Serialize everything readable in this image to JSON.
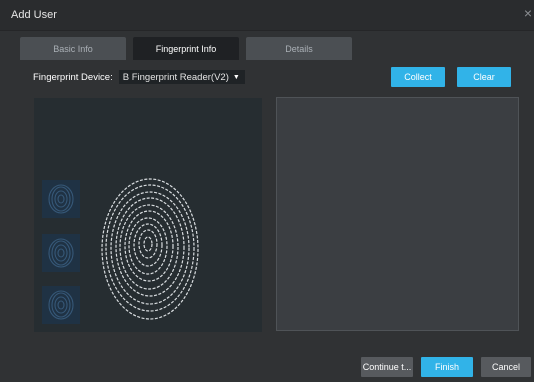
{
  "window": {
    "title": "Add User",
    "close_icon": "close-icon"
  },
  "tabs": [
    {
      "label": "Basic Info",
      "active": false
    },
    {
      "label": "Fingerprint Info",
      "active": true
    },
    {
      "label": "Details",
      "active": false
    }
  ],
  "device": {
    "label": "Fingerprint Device:",
    "value": "B Fingerprint Reader(V2)",
    "icon": "caret-down-icon"
  },
  "actions": {
    "collect": "Collect",
    "clear": "Clear"
  },
  "footer": {
    "continue": "Continue t...",
    "finish": "Finish",
    "cancel": "Cancel"
  },
  "colors": {
    "accent": "#31b3e8",
    "panel": "#262d31",
    "thumb": "#1f3244",
    "background": "#303234"
  }
}
